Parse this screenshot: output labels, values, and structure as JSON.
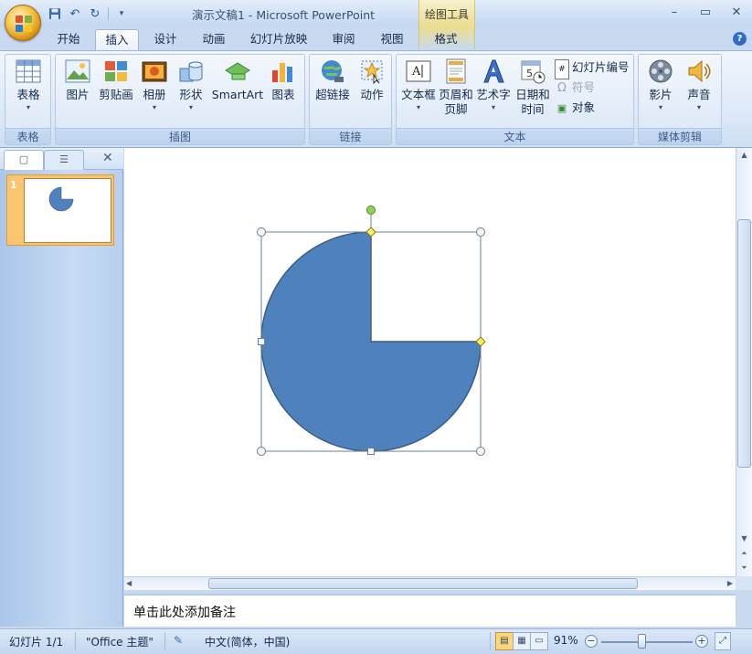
{
  "window": {
    "title": "演示文稿1 - Microsoft PowerPoint",
    "context_tool_label": "绘图工具",
    "controls": [
      "–",
      "▭",
      "✕"
    ]
  },
  "quick_access": {
    "icons": [
      "save-icon",
      "undo-icon",
      "redo-icon",
      "customize-icon"
    ]
  },
  "tabs": [
    {
      "label": "开始",
      "active": false
    },
    {
      "label": "插入",
      "active": true
    },
    {
      "label": "设计",
      "active": false
    },
    {
      "label": "动画",
      "active": false
    },
    {
      "label": "幻灯片放映",
      "active": false
    },
    {
      "label": "审阅",
      "active": false
    },
    {
      "label": "视图",
      "active": false
    },
    {
      "label": "格式",
      "active": false
    }
  ],
  "ribbon": {
    "groups": {
      "table": "表格",
      "illustrations": "插图",
      "links": "链接",
      "text": "文本",
      "media": "媒体剪辑"
    },
    "buttons": {
      "table": "表格",
      "picture": "图片",
      "clipart": "剪贴画",
      "album": "相册",
      "shapes": "形状",
      "smartart": "SmartArt",
      "chart": "图表",
      "hyperlink": "超链接",
      "action": "动作",
      "textbox": "文本框",
      "header_footer_1": "页眉和",
      "header_footer_2": "页脚",
      "wordart": "艺术字",
      "datetime_1": "日期和",
      "datetime_2": "时间",
      "slide_number": "幻灯片编号",
      "symbol": "符号",
      "object": "对象",
      "movie": "影片",
      "sound": "声音"
    }
  },
  "slides_pane": {
    "slide_number": "1"
  },
  "notes": {
    "placeholder": "单击此处添加备注"
  },
  "status": {
    "slide_info": "幻灯片 1/1",
    "theme": "\"Office 主题\"",
    "language": "中文(简体，中国)",
    "zoom": "91%"
  },
  "colors": {
    "shape_fill": "#4f81bd",
    "shape_stroke": "#385d8a",
    "rotate_handle": "#8fd34f",
    "adjust_handle": "#ffef5e",
    "accent": "#fbc56f"
  }
}
